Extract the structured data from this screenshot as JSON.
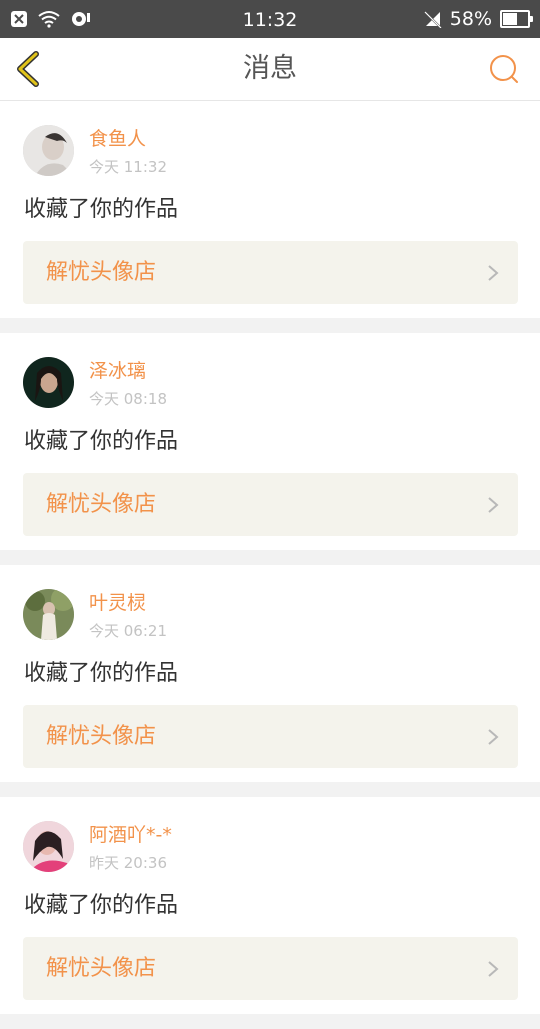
{
  "status_bar": {
    "time": "11:32",
    "battery_percent": "58%"
  },
  "header": {
    "title": "消息"
  },
  "colors": {
    "accent": "#f2924a",
    "back_icon": "#e0c31a"
  },
  "notifications": [
    {
      "username": "食鱼人",
      "time": "今天 11:32",
      "action": "收藏了你的作品",
      "shop": "解忧头像店"
    },
    {
      "username": "泽冰璃",
      "time": "今天 08:18",
      "action": "收藏了你的作品",
      "shop": "解忧头像店"
    },
    {
      "username": "叶灵棂",
      "time": "今天 06:21",
      "action": "收藏了你的作品",
      "shop": "解忧头像店"
    },
    {
      "username": "阿酒吖*-*",
      "time": "昨天 20:36",
      "action": "收藏了你的作品",
      "shop": "解忧头像店"
    }
  ]
}
